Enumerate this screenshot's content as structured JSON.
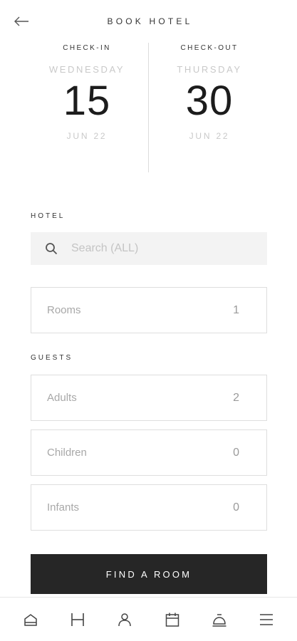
{
  "header": {
    "title": "BOOK HOTEL",
    "back_icon": "arrow-left-icon"
  },
  "dates": {
    "check_in": {
      "label": "CHECK-IN",
      "weekday": "WEDNESDAY",
      "day": "15",
      "month": "JUN 22"
    },
    "check_out": {
      "label": "CHECK-OUT",
      "weekday": "THURSDAY",
      "day": "30",
      "month": "JUN 22"
    }
  },
  "hotel": {
    "section_label": "HOTEL",
    "search_placeholder": "Search (ALL)",
    "search_value": "",
    "search_icon": "search-icon"
  },
  "rooms": {
    "label": "Rooms",
    "value": "1"
  },
  "guests": {
    "section_label": "GUESTS",
    "adults": {
      "label": "Adults",
      "value": "2"
    },
    "children": {
      "label": "Children",
      "value": "0"
    },
    "infants": {
      "label": "Infants",
      "value": "0"
    }
  },
  "actions": {
    "find_room_label": "FIND A ROOM"
  },
  "bottom_nav": {
    "items": [
      {
        "name": "home",
        "icon": "home-icon"
      },
      {
        "name": "hotel",
        "icon": "hotel-h-icon"
      },
      {
        "name": "profile",
        "icon": "user-icon"
      },
      {
        "name": "calendar",
        "icon": "calendar-icon"
      },
      {
        "name": "concierge",
        "icon": "service-bell-icon"
      },
      {
        "name": "menu",
        "icon": "hamburger-menu-icon"
      }
    ]
  },
  "colors": {
    "primary_button": "#262626",
    "muted_text": "#c9c9c9",
    "border": "#dedede",
    "search_bg": "#f3f3f3"
  }
}
